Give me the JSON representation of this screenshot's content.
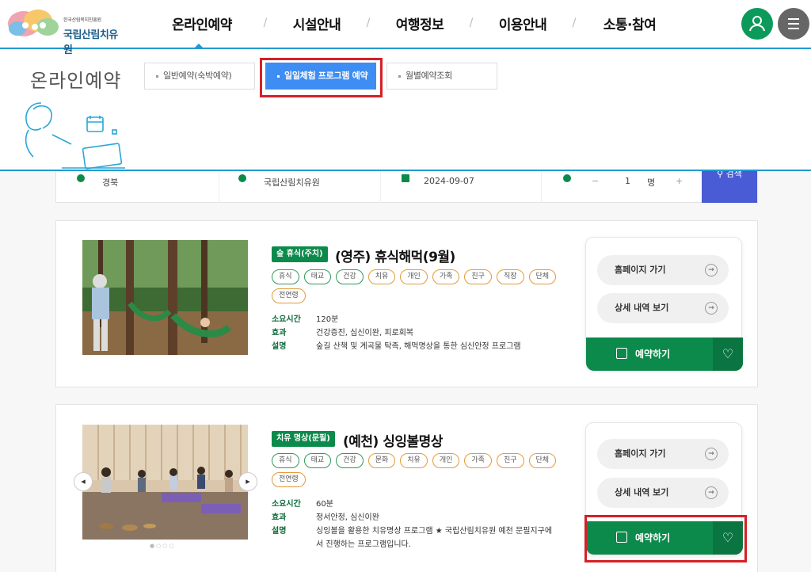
{
  "header": {
    "logo_sub": "한국산림복지진흥원",
    "logo_name": "국립산림치유원",
    "nav": [
      "온라인예약",
      "시설안내",
      "여행정보",
      "이용안내",
      "소통·참여"
    ],
    "nav_separator": "/",
    "accent": "#1f9bd0",
    "user_icon": "user-icon",
    "menu_icon": "hamburger-menu-icon"
  },
  "subnav": {
    "title": "온라인예약",
    "tabs": [
      {
        "label": "일반예약(숙박예약)",
        "active": false
      },
      {
        "label": "일일체험 프로그램 예약",
        "active": true
      },
      {
        "label": "월별예약조회",
        "active": false
      }
    ]
  },
  "search": {
    "region": "경북",
    "facility": "국립산림치유원",
    "date": "2024-09-07",
    "minus": "−",
    "count": "1",
    "unit": "명",
    "plus": "+",
    "button": "검색"
  },
  "programs": [
    {
      "badge": "숲 휴식(주치)",
      "title": "(영주) 휴식해먹(9월)",
      "tags": [
        "휴식",
        "태교",
        "건강",
        "치유",
        "개인",
        "가족",
        "친구",
        "직장",
        "단체",
        "전연령"
      ],
      "duration_label": "소요시간",
      "duration": "120분",
      "effect_label": "효과",
      "effect": "건강증진, 심신이완, 피로회복",
      "desc_label": "설명",
      "desc": "숲길 산책 및 계곡물 탁족, 해먹명상을 통한 심신안정 프로그램",
      "homepage": "홈페이지 가기",
      "detail": "상세 내역 보기",
      "reserve": "예약하기"
    },
    {
      "badge": "치유 명상(문필)",
      "title": "(예천) 싱잉볼명상",
      "tags": [
        "휴식",
        "태교",
        "건강",
        "문화",
        "치유",
        "개인",
        "가족",
        "친구",
        "단체",
        "전연령"
      ],
      "duration_label": "소요시간",
      "duration": "60분",
      "effect_label": "효과",
      "effect": "정서안정, 심신이완",
      "desc_label": "설명",
      "desc": "싱잉볼을 활용한 치유명상 프로그램 ★ 국립산림치유원 예천 문필지구에서 진행하는 프로그램입니다.",
      "homepage": "홈페이지 가기",
      "detail": "상세 내역 보기",
      "reserve": "예약하기"
    }
  ],
  "colors": {
    "green": "#0c8a4b",
    "blue_tab": "#3e8df2",
    "highlight": "#d52027",
    "search_btn": "#4a5bd6"
  }
}
